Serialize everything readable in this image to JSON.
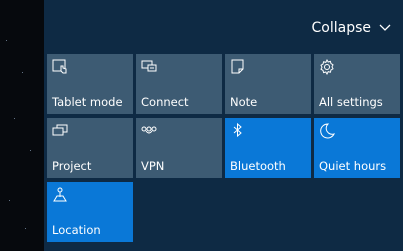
{
  "header": {
    "collapse_label": "Collapse"
  },
  "tiles": [
    {
      "label": "Tablet mode",
      "icon": "tablet-mode-icon",
      "state": "off"
    },
    {
      "label": "Connect",
      "icon": "connect-icon",
      "state": "off"
    },
    {
      "label": "Note",
      "icon": "note-icon",
      "state": "off"
    },
    {
      "label": "All settings",
      "icon": "settings-gear-icon",
      "state": "off"
    },
    {
      "label": "Project",
      "icon": "project-icon",
      "state": "off"
    },
    {
      "label": "VPN",
      "icon": "vpn-icon",
      "state": "off"
    },
    {
      "label": "Bluetooth",
      "icon": "bluetooth-icon",
      "state": "on"
    },
    {
      "label": "Quiet hours",
      "icon": "moon-icon",
      "state": "on"
    },
    {
      "label": "Location",
      "icon": "location-icon",
      "state": "on"
    }
  ],
  "colors": {
    "panel_bg": "#0e2a44",
    "tile_off": "#3d5b73",
    "tile_on": "#0a78d7",
    "text": "#ffffff"
  }
}
